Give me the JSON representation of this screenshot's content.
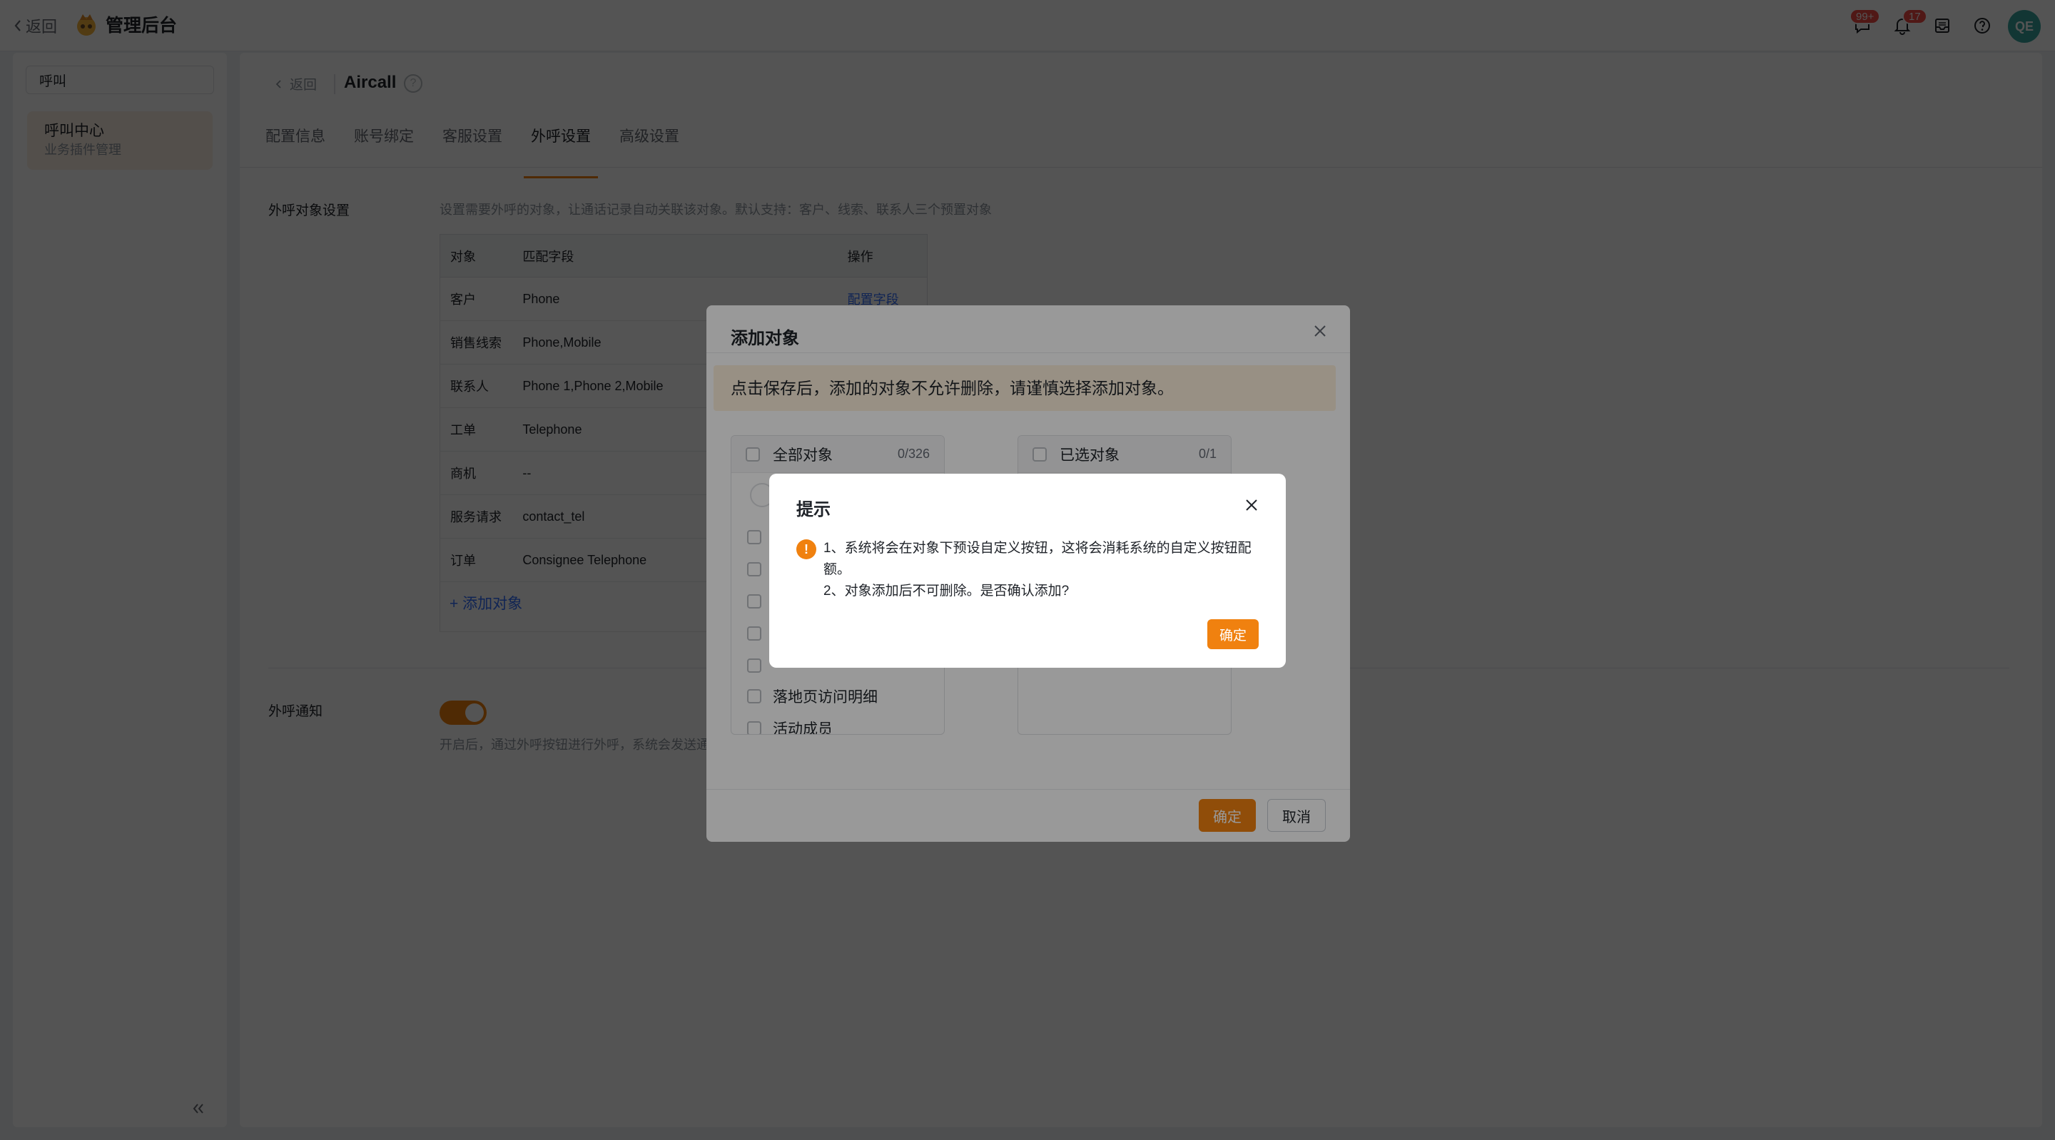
{
  "topbar": {
    "back_label": "返回",
    "app_title": "管理后台",
    "badges": {
      "messages": "99+",
      "notifications": "17"
    }
  },
  "avatar": {
    "initials": "QE"
  },
  "sidebar": {
    "search_value": "呼叫",
    "menu_item": {
      "title": "呼叫中心",
      "subtitle": "业务插件管理"
    }
  },
  "main": {
    "breadcrumb": {
      "back_label": "返回",
      "title": "Aircall",
      "help": "?"
    },
    "tabs": [
      "配置信息",
      "账号绑定",
      "客服设置",
      "外呼设置",
      "高级设置"
    ],
    "active_tab": "外呼设置",
    "outbound_objects": {
      "label": "外呼对象设置",
      "description": "设置需要外呼的对象，让通话记录自动关联该对象。默认支持：客户、线索、联系人三个预置对象",
      "columns": [
        "对象",
        "匹配字段",
        "操作"
      ],
      "rows": [
        {
          "object": "客户",
          "field": "Phone",
          "op": "配置字段"
        },
        {
          "object": "销售线索",
          "field": "Phone,Mobile",
          "op": ""
        },
        {
          "object": "联系人",
          "field": "Phone 1,Phone 2,Mobile",
          "op": ""
        },
        {
          "object": "工单",
          "field": "Telephone",
          "op": ""
        },
        {
          "object": "商机",
          "field": "--",
          "op": ""
        },
        {
          "object": "服务请求",
          "field": "contact_tel",
          "op": ""
        },
        {
          "object": "订单",
          "field": "Consignee Telephone",
          "op": ""
        }
      ],
      "add_label": "+ 添加对象"
    },
    "outbound_notify": {
      "label": "外呼通知",
      "enabled": true,
      "description": "开启后，通过外呼按钮进行外呼，系统会发送通"
    }
  },
  "add_dialog": {
    "title": "添加对象",
    "warning": "点击保存后，添加的对象不允许删除，请谨慎选择添加对象。",
    "left_panel": {
      "title": "全部对象",
      "count": "0/326",
      "visible_items": [
        "落地页访问明细",
        "活动成员"
      ]
    },
    "right_panel": {
      "title": "已选对象",
      "count": "0/1"
    },
    "ok_label": "确定",
    "cancel_label": "取消"
  },
  "confirm_dialog": {
    "title": "提示",
    "icon": "!",
    "line1": "1、系统将会在对象下预设自定义按钮，这将会消耗系统的自定义按钮配额。",
    "line2": "2、对象添加后不可删除。是否确认添加?",
    "ok_label": "确定"
  },
  "colors": {
    "accent": "#f0810f",
    "link": "#3370ff",
    "danger": "#f54a45"
  }
}
